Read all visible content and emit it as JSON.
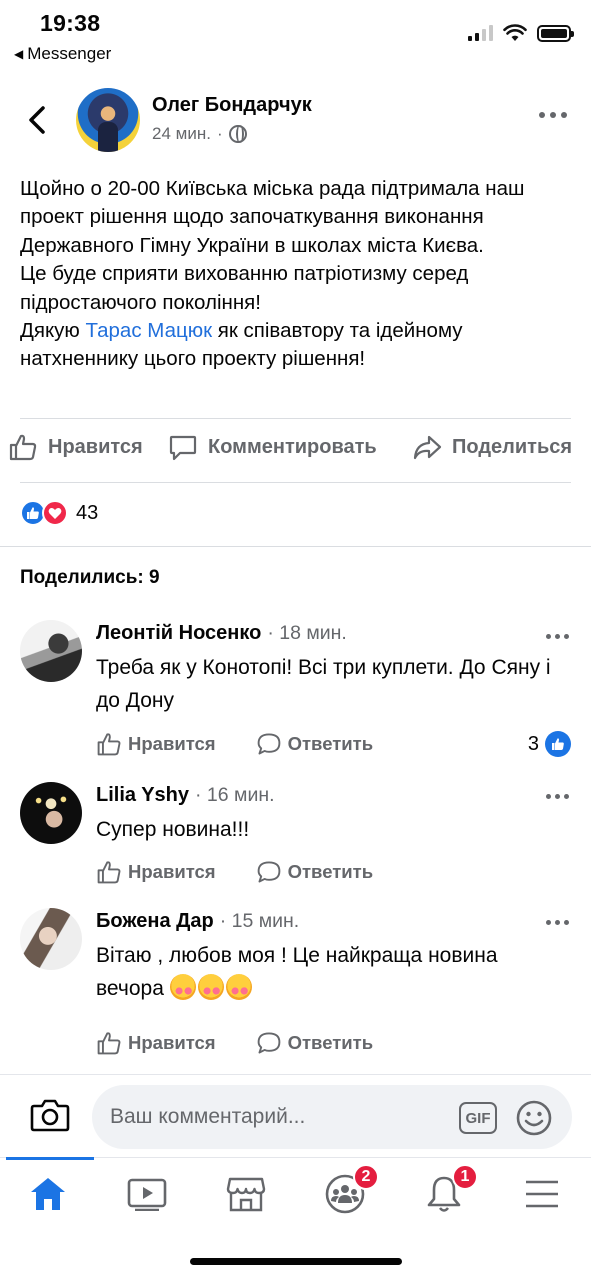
{
  "status_bar": {
    "time": "19:38",
    "back_app": "Messenger"
  },
  "post": {
    "author": "Олег Бондарчук",
    "time": "24 мин.",
    "text_before_link": "Щойно о 20-00 Київська міська рада підтримала наш проект рішення щодо започаткування виконання Державного Гімну України в школах міста Києва.\nЦе буде сприяти вихованню патріотизму серед підростаючого покоління!\nДякую ",
    "link_text": "Тарас Мацюк",
    "text_after_link": " як співавтору та ідейному натхненнику цього проекту рішення!",
    "actions": {
      "like": "Нравится",
      "comment": "Комментировать",
      "share": "Поделиться"
    },
    "reaction_count": "43",
    "shares_label": "Поделились: 9"
  },
  "comments": [
    {
      "name": "Леонтій Носенко",
      "time": "· 18 мин.",
      "text": "Треба як у Конотопі! Всі три куплети.  До Сяну і до Дону",
      "like": "Нравится",
      "reply": "Ответить",
      "reaction_count": "3"
    },
    {
      "name": "Lilia Yshy",
      "time": "· 16 мин.",
      "text": "Супер новина!!!",
      "like": "Нравится",
      "reply": "Ответить"
    },
    {
      "name": "Божена Дар",
      "time": "· 15 мин.",
      "text": "Вітаю , любов моя ! Це найкраща новина вечора",
      "like": "Нравится",
      "reply": "Ответить"
    }
  ],
  "composer": {
    "placeholder": "Ваш комментарий...",
    "gif": "GIF"
  },
  "nav": {
    "groups_badge": "2",
    "notifications_badge": "1"
  },
  "colors": {
    "accent": "#1b74e4",
    "link": "#216fdb",
    "badge": "#e41e3f",
    "secondary_text": "#65676b"
  },
  "icons": [
    "chevron-left-icon",
    "globe-icon",
    "more-icon",
    "thumbs-up-icon",
    "comment-icon",
    "share-icon",
    "like-reaction-icon",
    "love-reaction-icon",
    "camera-icon",
    "gif-icon",
    "smiley-icon",
    "home-icon",
    "video-icon",
    "marketplace-icon",
    "groups-icon",
    "bell-icon",
    "menu-icon",
    "smiling-face-with-hearts-emoji"
  ]
}
